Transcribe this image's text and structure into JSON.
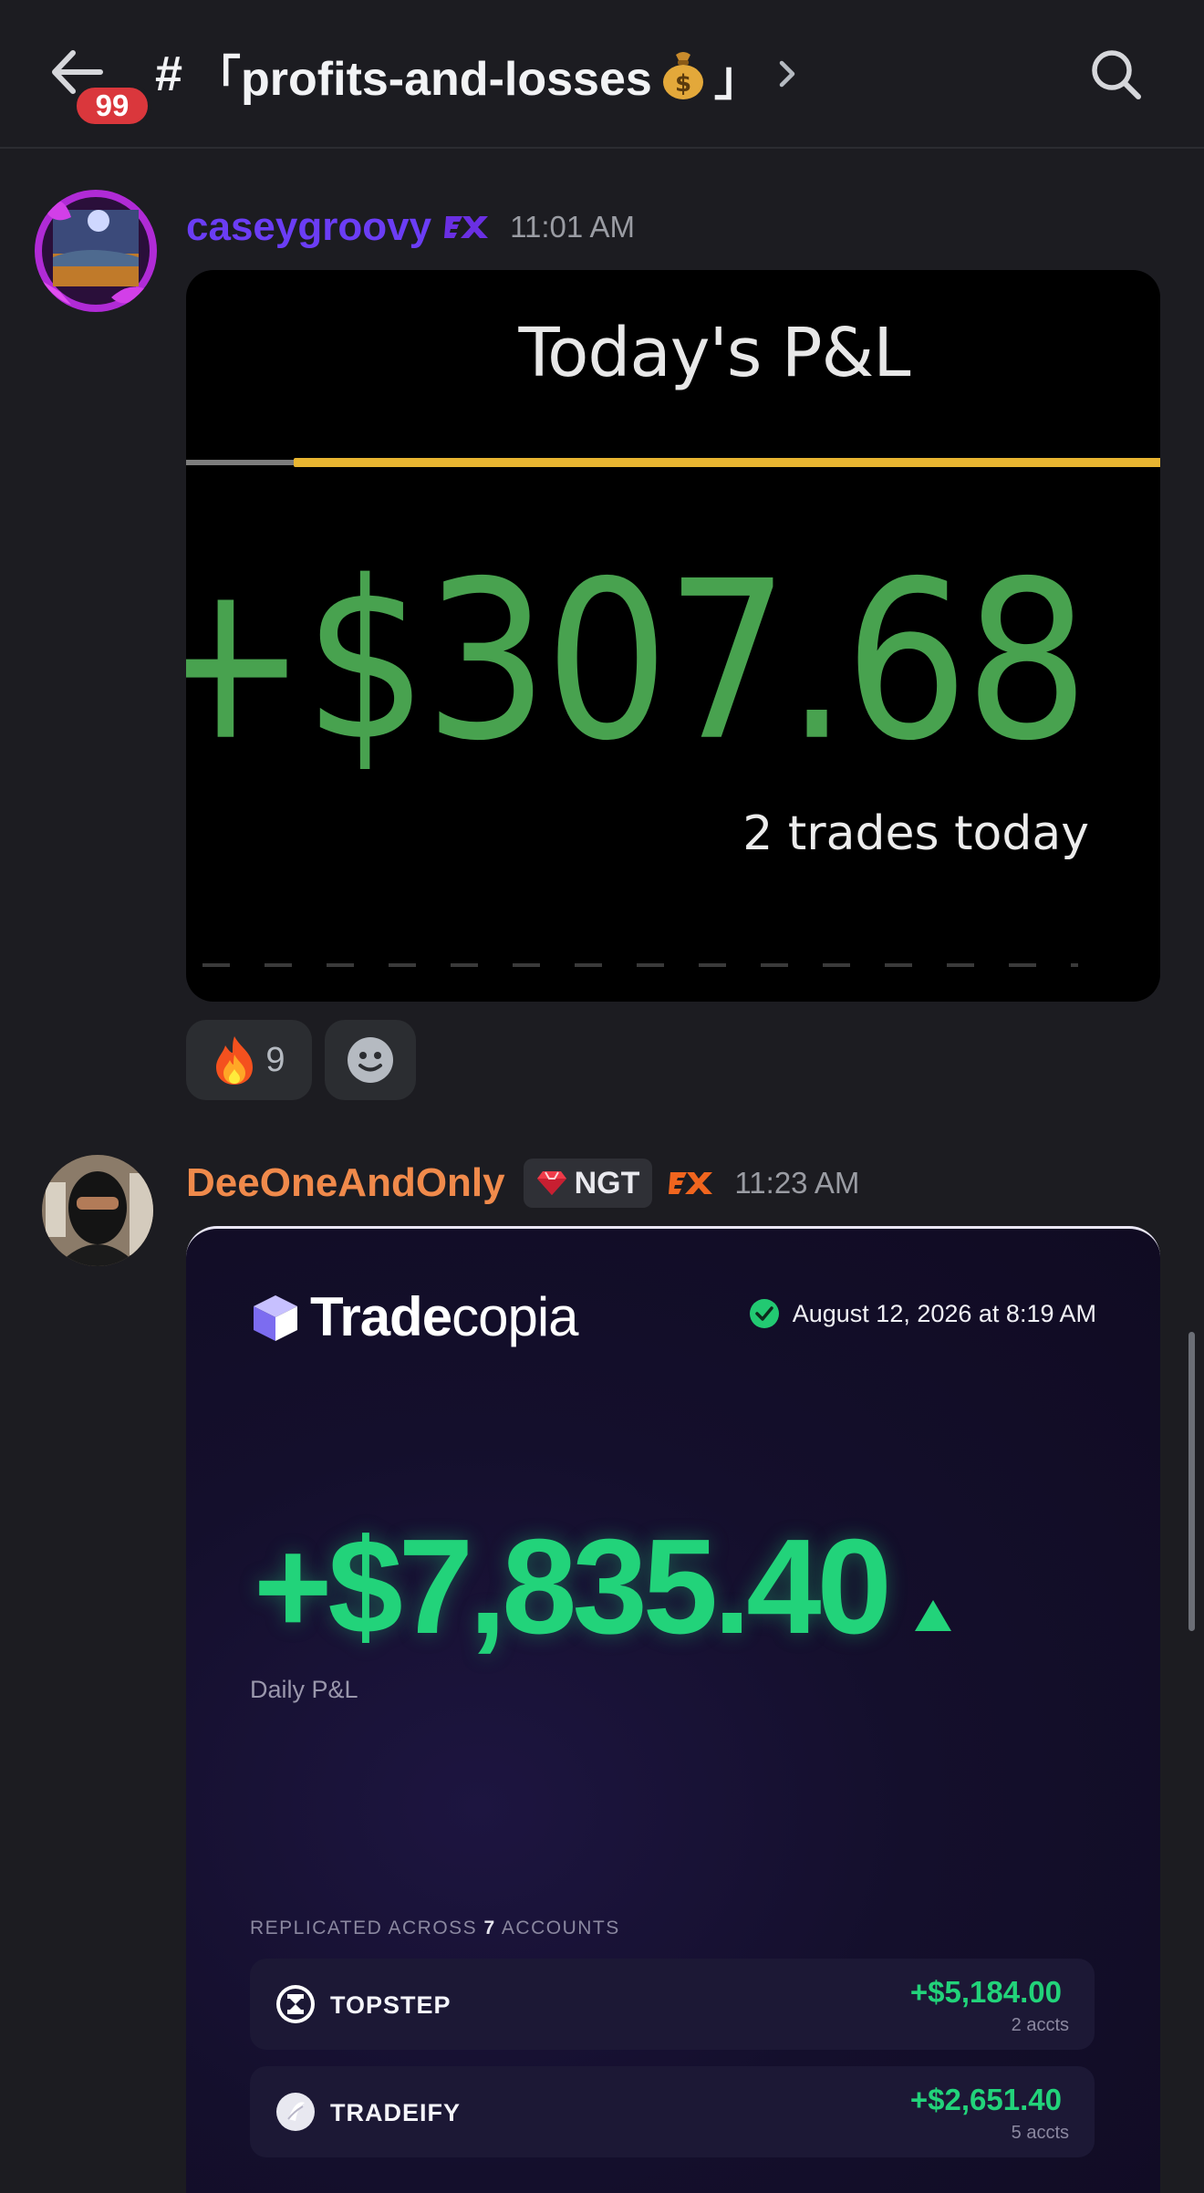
{
  "header": {
    "unread_count": "99",
    "hash": "#",
    "channel_name_prefix": "「profits-and-losses",
    "channel_name_suffix": "」",
    "money_icon": "money-bag-icon"
  },
  "messages": [
    {
      "username": "caseygroovy",
      "username_color": "#6b3df5",
      "tag_icon": "ex-tag-icon",
      "timestamp": "11:01 AM",
      "card": {
        "title": "Today's P&L",
        "amount": "+$307.68",
        "amount_color": "#48a24f",
        "trades_text": "2 trades today",
        "progress_fraction": 0.89
      },
      "reactions": [
        {
          "emoji": "fire",
          "count": "9"
        },
        {
          "emoji": "add-reaction",
          "count": ""
        }
      ]
    },
    {
      "username": "DeeOneAndOnly",
      "username_color": "#f08a4b",
      "badge_label": "NGT",
      "tag_icon": "ex-tag-icon",
      "timestamp": "11:23 AM",
      "card": {
        "brand_bold": "Trade",
        "brand_light": "copia",
        "date": "August 12, 2026 at 8:19 AM",
        "amount": "+$7,835.40",
        "amount_label": "Daily P&L",
        "replicated_prefix": "REPLICATED ACROSS",
        "replicated_count": "7",
        "replicated_suffix": "ACCOUNTS",
        "accounts": [
          {
            "name": "TOPSTEP",
            "value": "+$5,184.00",
            "sub": "2 accts"
          },
          {
            "name": "TRADEIFY",
            "value": "+$2,651.40",
            "sub": "5 accts"
          }
        ]
      }
    }
  ]
}
